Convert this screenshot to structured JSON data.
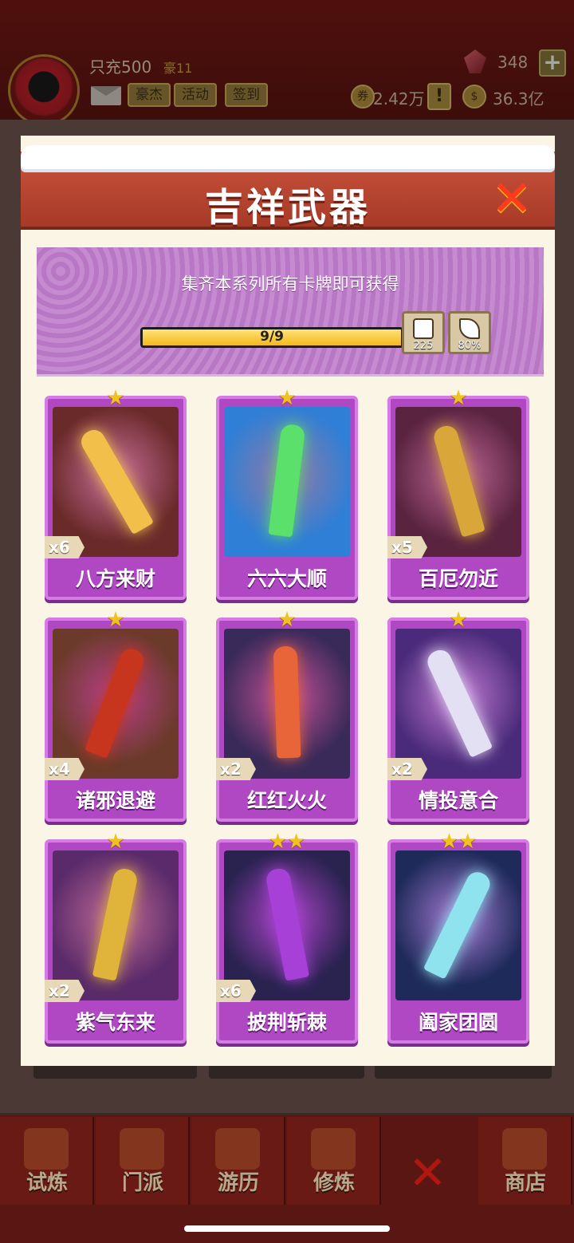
{
  "player": {
    "nickname": "只充500",
    "vip": "豪11",
    "buttons": [
      "豪杰",
      "活动",
      "签到"
    ]
  },
  "resources": {
    "gems": "348",
    "stamps": "2.42万",
    "coins": "36.3亿"
  },
  "dialog": {
    "title": "吉祥武器",
    "subtitle": "集齐本系列所有卡牌即可获得",
    "progress_text": "9/9",
    "progress_fraction": 1.0,
    "rewards": [
      {
        "icon": "dice-icon",
        "value": "225"
      },
      {
        "icon": "knife-icon",
        "value": "80%"
      }
    ]
  },
  "cards": [
    {
      "name": "八方来财",
      "count": "x6",
      "stars": 1,
      "bg": "#6b2a2a",
      "accent": "#f2c04a"
    },
    {
      "name": "六六大顺",
      "count": "",
      "stars": 1,
      "bg": "#2f7fd6",
      "accent": "#5be06b"
    },
    {
      "name": "百厄勿近",
      "count": "x5",
      "stars": 1,
      "bg": "#5a2340",
      "accent": "#d9a63a"
    },
    {
      "name": "诸邪退避",
      "count": "x4",
      "stars": 1,
      "bg": "#6b3a2a",
      "accent": "#c7351f"
    },
    {
      "name": "红红火火",
      "count": "x2",
      "stars": 1,
      "bg": "#3a2a5a",
      "accent": "#e8653a"
    },
    {
      "name": "情投意合",
      "count": "x2",
      "stars": 1,
      "bg": "#4a2a7a",
      "accent": "#e4e0f4"
    },
    {
      "name": "紫气东来",
      "count": "x2",
      "stars": 1,
      "bg": "#5a2a6a",
      "accent": "#e0b43a"
    },
    {
      "name": "披荆斩棘",
      "count": "x6",
      "stars": 2,
      "bg": "#2a2350",
      "accent": "#a640d6"
    },
    {
      "name": "阖家团圆",
      "count": "",
      "stars": 2,
      "bg": "#1e2a5a",
      "accent": "#8fe3ef"
    }
  ],
  "background_tabs": [
    "",
    "",
    ""
  ],
  "nav": [
    {
      "label": "试炼",
      "icon": "trial-icon"
    },
    {
      "label": "门派",
      "icon": "sect-icon"
    },
    {
      "label": "游历",
      "icon": "travel-icon"
    },
    {
      "label": "修炼",
      "icon": "cultivate-icon"
    },
    {
      "label": "",
      "icon": "close-icon"
    },
    {
      "label": "商店",
      "icon": "shop-icon"
    }
  ]
}
